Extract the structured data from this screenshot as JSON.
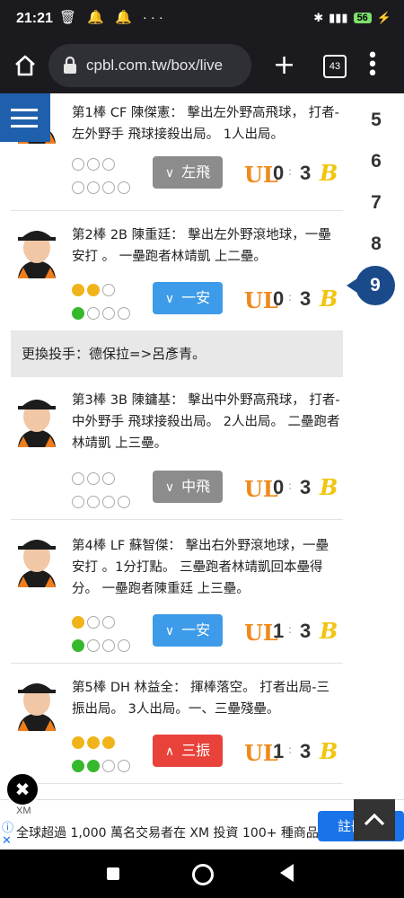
{
  "status": {
    "time": "21:21",
    "battery": "56"
  },
  "browser": {
    "url": "cpbl.com.tw/box/live",
    "tab_count": "43"
  },
  "inning_nav": [
    "5",
    "6",
    "7",
    "8",
    "9"
  ],
  "active_inning": "9",
  "teams": {
    "away_logo": "UL",
    "home_logo": "B"
  },
  "plays": [
    {
      "text": "第1棒 CF 陳傑憲： 擊出左外野高飛球， 打者-左外野手 飛球接殺出局。 1人出局。",
      "bases": [
        "off",
        "off",
        "off"
      ],
      "count": [
        "off",
        "off",
        "off",
        "off"
      ],
      "result": "左飛",
      "result_color": "#8c8c8c",
      "arrow": "down",
      "away": "0",
      "home": "3"
    },
    {
      "text": "第2棒 2B 陳重廷： 擊出左外野滾地球，一壘安打 。 一壘跑者林靖凱 上二壘。",
      "bases": [
        "y",
        "y",
        "off"
      ],
      "count": [
        "g",
        "off",
        "off",
        "off"
      ],
      "result": "一安",
      "result_color": "#3d9be9",
      "arrow": "down",
      "away": "0",
      "home": "3"
    },
    {
      "text": "第3棒 3B 陳鏞基： 擊出中外野高飛球， 打者-中外野手 飛球接殺出局。 2人出局。 二壘跑者林靖凱 上三壘。",
      "bases": [
        "off",
        "off",
        "off"
      ],
      "count": [
        "off",
        "off",
        "off",
        "off"
      ],
      "result": "中飛",
      "result_color": "#8c8c8c",
      "arrow": "down",
      "away": "0",
      "home": "3"
    },
    {
      "text": "第4棒 LF 蘇智傑： 擊出右外野滾地球，一壘安打 。1分打點。 三壘跑者林靖凱回本壘得分。 一壘跑者陳重廷 上三壘。",
      "bases": [
        "y",
        "off",
        "off"
      ],
      "count": [
        "g",
        "off",
        "off",
        "off"
      ],
      "result": "一安",
      "result_color": "#3d9be9",
      "arrow": "down",
      "away": "1",
      "home": "3"
    },
    {
      "text": "第5棒 DH 林益全： 揮棒落空。 打者出局-三振出局。 3人出局。一、三壘殘壘。",
      "bases": [
        "y",
        "y",
        "y"
      ],
      "count": [
        "g",
        "g",
        "off",
        "off"
      ],
      "result": "三振",
      "result_color": "#e8423a",
      "arrow": "up",
      "away": "1",
      "home": "3"
    }
  ],
  "pitcher_change": "更換投手：德保拉=>呂彥青。",
  "ad": {
    "brand": "XM",
    "text": "全球超過 1,000 萬名交易者在 XM 投資 100+ 種商品",
    "cta": "註冊"
  }
}
